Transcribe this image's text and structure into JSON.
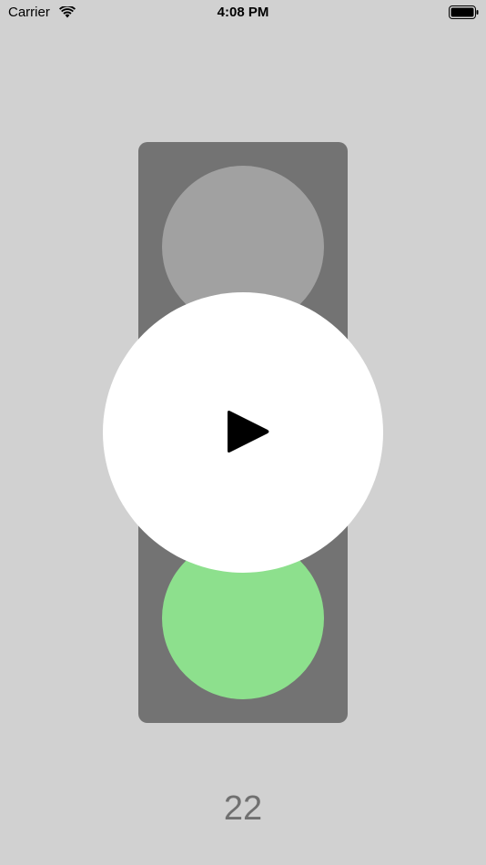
{
  "status_bar": {
    "carrier": "Carrier",
    "time": "4:08 PM",
    "wifi_icon": "wifi-icon",
    "battery_icon": "battery-full-icon"
  },
  "traffic_light": {
    "housing_color": "#737373",
    "top_lamp_color": "#a1a1a1",
    "bottom_lamp_color": "#8de08d",
    "active_lamp": "green"
  },
  "play_button": {
    "icon": "play-icon",
    "color": "#ffffff"
  },
  "counter": {
    "value": "22"
  },
  "background_color": "#d1d1d1"
}
